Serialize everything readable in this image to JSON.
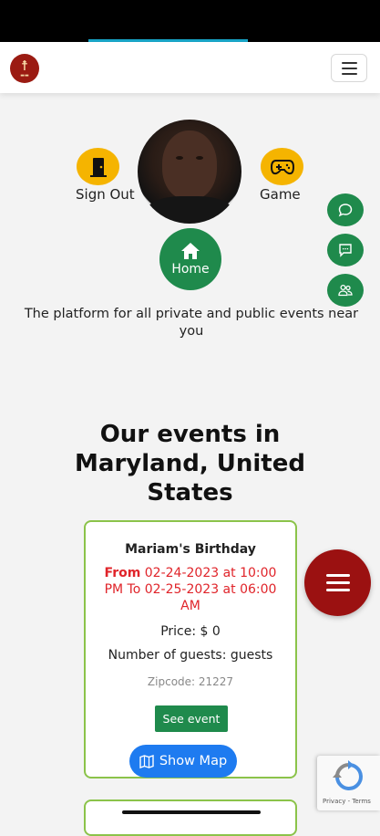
{
  "navbar": {
    "logo_icon": "logo-icon",
    "menu_icon": "hamburger-icon"
  },
  "profile": {
    "sign_out_label": "Sign Out",
    "game_label": "Game",
    "home_label": "Home"
  },
  "side_actions": [
    "chat-icon",
    "message-icon",
    "users-icon"
  ],
  "tagline": "The platform for all private and public events near you",
  "heading": "Our events in Maryland, United States",
  "events": [
    {
      "title": "Mariam's Birthday",
      "from_label": "From",
      "dates_rest": "02-24-2023 at 10:00 PM To 02-25-2023 at 06:00 AM",
      "price": "Price: $ 0",
      "guests": "Number of guests: guests",
      "zipcode": "Zipcode: 21227",
      "see_event_label": "See event",
      "show_map_label": "Show Map"
    }
  ],
  "recaptcha": {
    "terms": "Privacy - Terms"
  },
  "colors": {
    "accent_green": "#1f8a4c",
    "brand_red": "#9b1111",
    "alert_red": "#e0242a",
    "map_blue": "#1e7bf0",
    "yellow": "#f5b400"
  }
}
